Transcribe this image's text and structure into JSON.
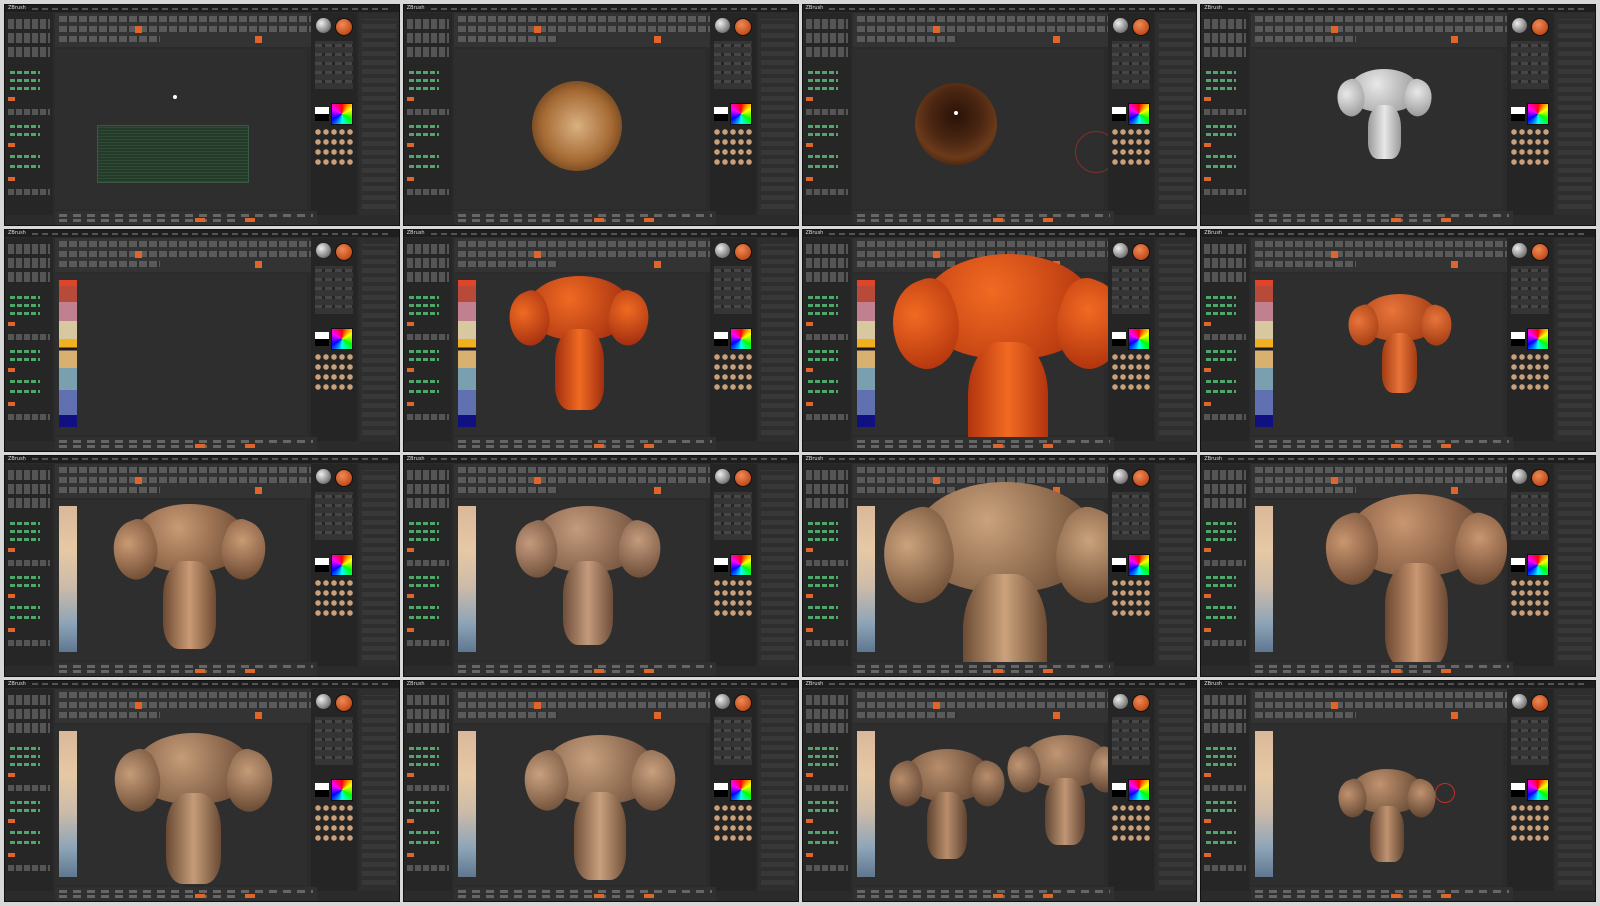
{
  "app": {
    "title": "ZBrush"
  },
  "frames": [
    {
      "label": "frame-1-plane"
    },
    {
      "label": "frame-2-sphere-brown"
    },
    {
      "label": "frame-3-sphere-dark"
    },
    {
      "label": "frame-4-white-bust"
    },
    {
      "label": "frame-5-gradient-stripe"
    },
    {
      "label": "frame-6-orange-head"
    },
    {
      "label": "frame-7-orange-closeup"
    },
    {
      "label": "frame-8-orange-small"
    },
    {
      "label": "frame-9-tan-bust"
    },
    {
      "label": "frame-10-tan-front"
    },
    {
      "label": "frame-11-tan-closeup"
    },
    {
      "label": "frame-12-tan-side"
    },
    {
      "label": "frame-13-tan-three-quarter"
    },
    {
      "label": "frame-14-tan-turned"
    },
    {
      "label": "frame-15-two-busts"
    },
    {
      "label": "frame-16-small-bust"
    }
  ],
  "colors": {
    "accent": "#e0652a",
    "ui_dark": "#2b2b2b",
    "skin_orange": "#e0501a",
    "skin_tan": "#b98a66",
    "white_sculpt": "#e8e8e8"
  },
  "icons": {
    "brush_preview": "brush-sphere-icon",
    "material_preview": "material-sphere-icon",
    "color_picker": "color-picker-icon"
  }
}
